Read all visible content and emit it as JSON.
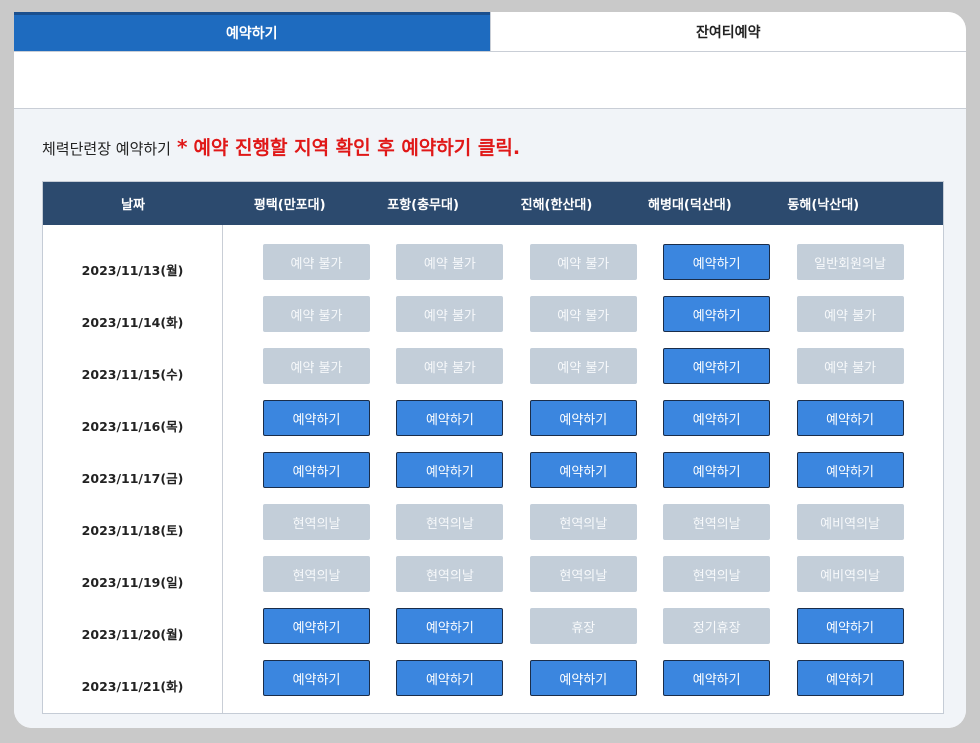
{
  "tabs": [
    {
      "label": "예약하기",
      "active": true
    },
    {
      "label": "잔여티예약",
      "active": false
    }
  ],
  "heading": {
    "label": "체력단련장 예약하기",
    "star": "*",
    "notice": "예약 진행할 지역 확인 후 예약하기 클릭."
  },
  "table": {
    "date_header": "날짜",
    "locations": [
      "평택(만포대)",
      "포항(충무대)",
      "진해(한산대)",
      "해병대(덕산대)",
      "동해(낙산대)"
    ],
    "rows": [
      {
        "date": "2023/11/13(월)",
        "cells": [
          {
            "label": "예약 불가",
            "enabled": false
          },
          {
            "label": "예약 불가",
            "enabled": false
          },
          {
            "label": "예약 불가",
            "enabled": false
          },
          {
            "label": "예약하기",
            "enabled": true
          },
          {
            "label": "일반회원의날",
            "enabled": false
          }
        ]
      },
      {
        "date": "2023/11/14(화)",
        "cells": [
          {
            "label": "예약 불가",
            "enabled": false
          },
          {
            "label": "예약 불가",
            "enabled": false
          },
          {
            "label": "예약 불가",
            "enabled": false
          },
          {
            "label": "예약하기",
            "enabled": true
          },
          {
            "label": "예약 불가",
            "enabled": false
          }
        ]
      },
      {
        "date": "2023/11/15(수)",
        "cells": [
          {
            "label": "예약 불가",
            "enabled": false
          },
          {
            "label": "예약 불가",
            "enabled": false
          },
          {
            "label": "예약 불가",
            "enabled": false
          },
          {
            "label": "예약하기",
            "enabled": true
          },
          {
            "label": "예약 불가",
            "enabled": false
          }
        ]
      },
      {
        "date": "2023/11/16(목)",
        "cells": [
          {
            "label": "예약하기",
            "enabled": true
          },
          {
            "label": "예약하기",
            "enabled": true
          },
          {
            "label": "예약하기",
            "enabled": true
          },
          {
            "label": "예약하기",
            "enabled": true
          },
          {
            "label": "예약하기",
            "enabled": true
          }
        ]
      },
      {
        "date": "2023/11/17(금)",
        "cells": [
          {
            "label": "예약하기",
            "enabled": true
          },
          {
            "label": "예약하기",
            "enabled": true
          },
          {
            "label": "예약하기",
            "enabled": true
          },
          {
            "label": "예약하기",
            "enabled": true
          },
          {
            "label": "예약하기",
            "enabled": true
          }
        ]
      },
      {
        "date": "2023/11/18(토)",
        "cells": [
          {
            "label": "현역의날",
            "enabled": false
          },
          {
            "label": "현역의날",
            "enabled": false
          },
          {
            "label": "현역의날",
            "enabled": false
          },
          {
            "label": "현역의날",
            "enabled": false
          },
          {
            "label": "예비역의날",
            "enabled": false
          }
        ]
      },
      {
        "date": "2023/11/19(일)",
        "cells": [
          {
            "label": "현역의날",
            "enabled": false
          },
          {
            "label": "현역의날",
            "enabled": false
          },
          {
            "label": "현역의날",
            "enabled": false
          },
          {
            "label": "현역의날",
            "enabled": false
          },
          {
            "label": "예비역의날",
            "enabled": false
          }
        ]
      },
      {
        "date": "2023/11/20(월)",
        "cells": [
          {
            "label": "예약하기",
            "enabled": true
          },
          {
            "label": "예약하기",
            "enabled": true
          },
          {
            "label": "휴장",
            "enabled": false
          },
          {
            "label": "정기휴장",
            "enabled": false
          },
          {
            "label": "예약하기",
            "enabled": true
          }
        ]
      },
      {
        "date": "2023/11/21(화)",
        "cells": [
          {
            "label": "예약하기",
            "enabled": true
          },
          {
            "label": "예약하기",
            "enabled": true
          },
          {
            "label": "예약하기",
            "enabled": true
          },
          {
            "label": "예약하기",
            "enabled": true
          },
          {
            "label": "예약하기",
            "enabled": true
          }
        ]
      }
    ]
  },
  "colors": {
    "tab_active": "#1e6bbf",
    "header_bg": "#2c4a6e",
    "button_enabled": "#3b86df",
    "button_disabled": "#c3ced9",
    "notice_red": "#e01818"
  }
}
